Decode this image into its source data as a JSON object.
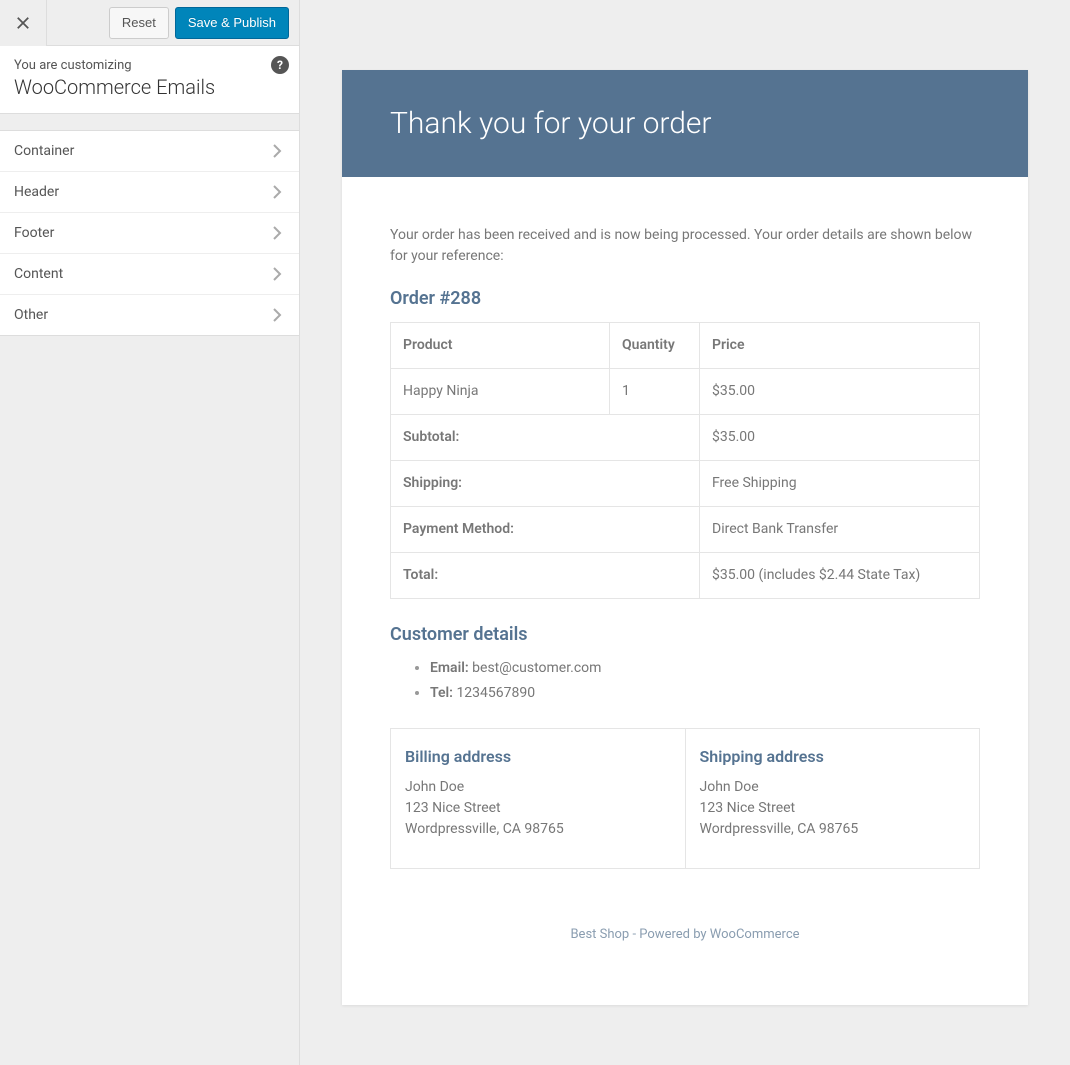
{
  "sidebar": {
    "reset_label": "Reset",
    "save_label": "Save & Publish",
    "customizing_text": "You are customizing",
    "section_title": "WooCommerce Emails",
    "menu": [
      {
        "label": "Container"
      },
      {
        "label": "Header"
      },
      {
        "label": "Footer"
      },
      {
        "label": "Content"
      },
      {
        "label": "Other"
      }
    ]
  },
  "email": {
    "title": "Thank you for your order",
    "intro": "Your order has been received and is now being processed. Your order details are shown below for your reference:",
    "order_heading": "Order #288",
    "columns": {
      "product": "Product",
      "quantity": "Quantity",
      "price": "Price"
    },
    "items": [
      {
        "product": "Happy Ninja",
        "quantity": "1",
        "price": "$35.00"
      }
    ],
    "totals": [
      {
        "label": "Subtotal:",
        "value": "$35.00"
      },
      {
        "label": "Shipping:",
        "value": "Free Shipping"
      },
      {
        "label": "Payment Method:",
        "value": "Direct Bank Transfer"
      },
      {
        "label": "Total:",
        "value": "$35.00 (includes $2.44 State Tax)"
      }
    ],
    "customer_heading": "Customer details",
    "customer": {
      "email_label": "Email:",
      "email_value": "best@customer.com",
      "tel_label": "Tel:",
      "tel_value": "1234567890"
    },
    "billing": {
      "heading": "Billing address",
      "name": "John Doe",
      "street": "123 Nice Street",
      "city": "Wordpressville, CA 98765"
    },
    "shipping": {
      "heading": "Shipping address",
      "name": "John Doe",
      "street": "123 Nice Street",
      "city": "Wordpressville, CA 98765"
    },
    "footer_text": "Best Shop - Powered by WooCommerce"
  }
}
